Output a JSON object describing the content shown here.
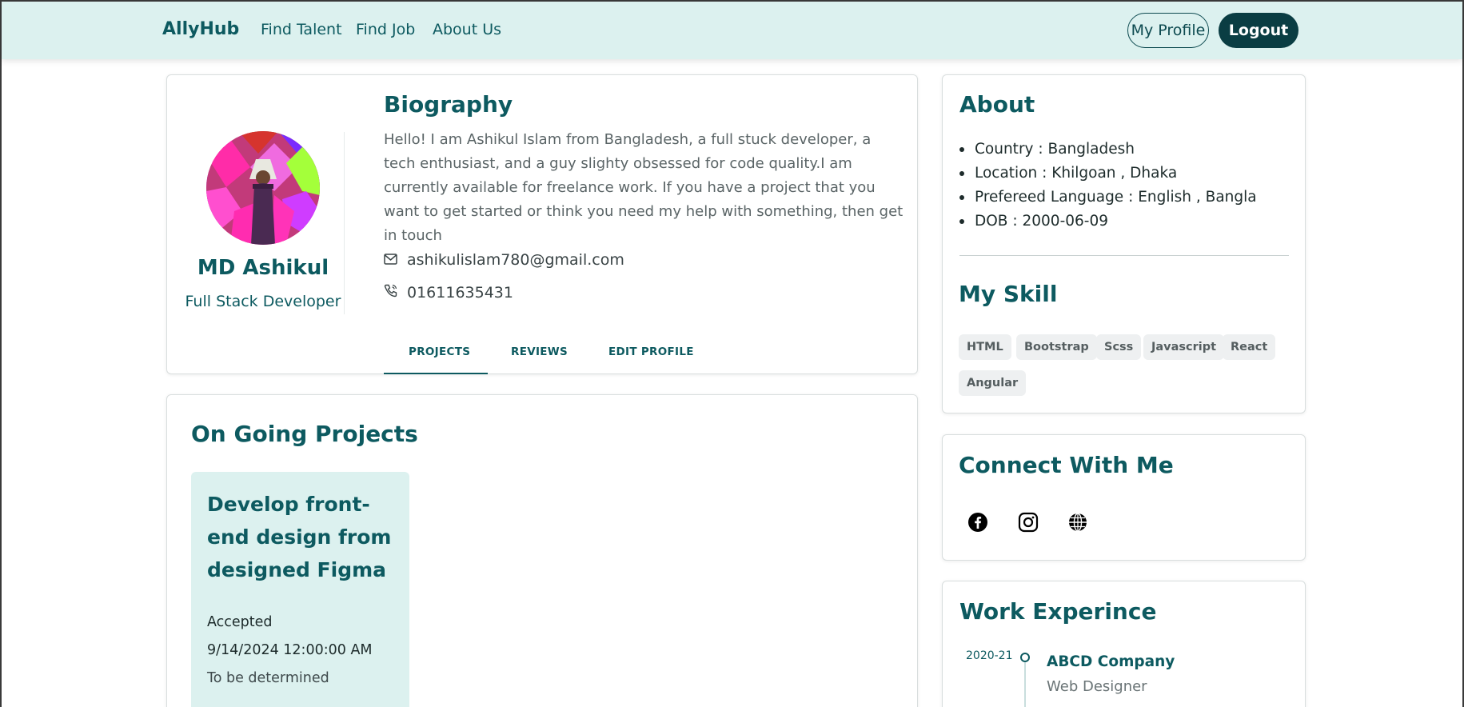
{
  "nav": {
    "brand": "AllyHub",
    "links": [
      "Find Talent",
      "Find Job",
      "About Us"
    ],
    "my_profile": "My Profile",
    "logout": "Logout"
  },
  "profile": {
    "name": "MD Ashikul",
    "role": "Full Stack Developer",
    "bio_title": "Biography",
    "bio": "Hello! I am Ashikul Islam from Bangladesh, a full stuck developer, a tech enthusiast, and a guy slighty obsessed for code quality.I am currently available for freelance work. If you have a project that you want to get started or think you need my help with something, then get in touch",
    "email": "ashikulislam780@gmail.com",
    "phone": "01611635431",
    "tabs": [
      "PROJECTS",
      "REVIEWS",
      "EDIT PROFILE"
    ],
    "active_tab": "PROJECTS"
  },
  "projects": {
    "title": "On Going Projects",
    "items": [
      {
        "title": "Develop front-end design from designed Figma",
        "status": "Accepted",
        "date": "9/14/2024 12:00:00 AM",
        "deadline": "To be determined"
      }
    ]
  },
  "about": {
    "title": "About",
    "items": [
      {
        "label": "Country",
        "value": "Bangladesh"
      },
      {
        "label": "Location",
        "value": "Khilgoan , Dhaka"
      },
      {
        "label": "Prefereed Language",
        "value": "English , Bangla"
      },
      {
        "label": "DOB",
        "value": "2000-06-09"
      }
    ]
  },
  "skills": {
    "title": "My Skill",
    "items": [
      "HTML",
      "Bootstrap",
      "Scss",
      "Javascript",
      "React",
      "Angular"
    ]
  },
  "connect": {
    "title": "Connect With Me",
    "icons": [
      "facebook-icon",
      "instagram-icon",
      "globe-icon"
    ]
  },
  "experience": {
    "title": "Work Experince",
    "items": [
      {
        "period": "2020-21",
        "company": "ABCD Company",
        "position": "Web Designer"
      }
    ]
  },
  "colors": {
    "accent": "#0d5a60",
    "nav_bg": "#dcf1ef",
    "logout_bg": "#0a3d43"
  }
}
